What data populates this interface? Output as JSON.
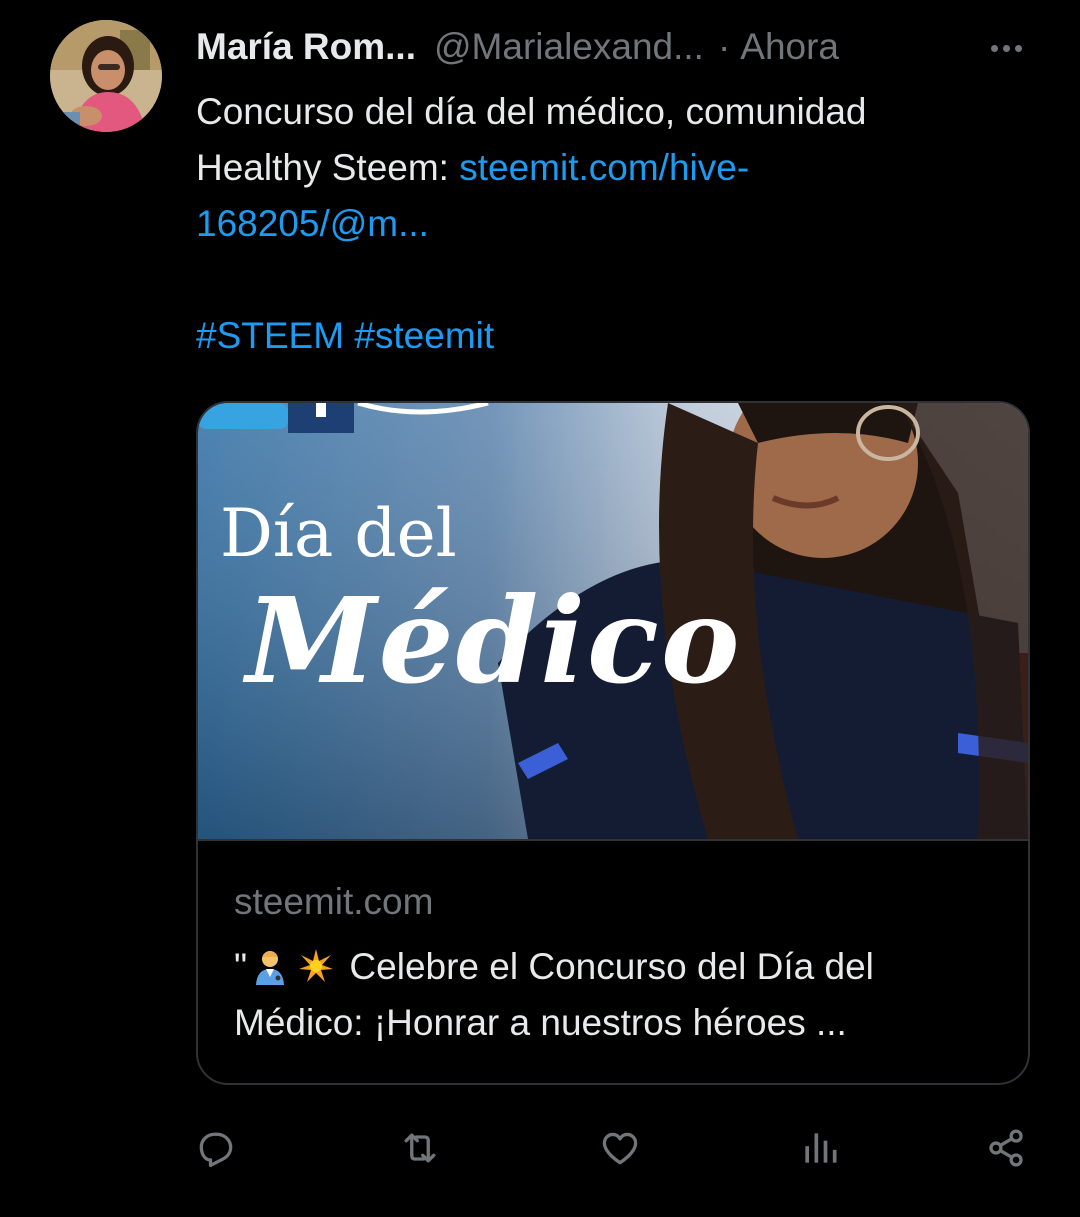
{
  "tweet": {
    "author": {
      "display_name": "María Rom...",
      "handle": "@Marialexand...",
      "separator": "·",
      "time": "Ahora"
    },
    "body": {
      "line1": "Concurso del día del médico, comunidad",
      "line2_text": "Healthy Steem: ",
      "line2_link": "steemit.com/hive-",
      "line3_link": "168205/@m...",
      "hashtag1": "#STEEM",
      "hashtag2": "#steemit"
    },
    "card": {
      "image_text_line1": "Día del",
      "image_text_line2": "Médico",
      "domain": "steemit.com",
      "title_prefix": "\"",
      "title_line1_rest": "Celebre el Concurso del Día del",
      "title_line2": "Médico: ¡Honrar a nuestros héroes ..."
    },
    "actions": {
      "icons": [
        "reply-icon",
        "retweet-icon",
        "like-icon",
        "views-icon",
        "share-icon"
      ]
    },
    "colors": {
      "background": "#000000",
      "text": "#e7e9ea",
      "muted": "#71767b",
      "link": "#1d9bf0",
      "border": "#2f3336"
    }
  }
}
